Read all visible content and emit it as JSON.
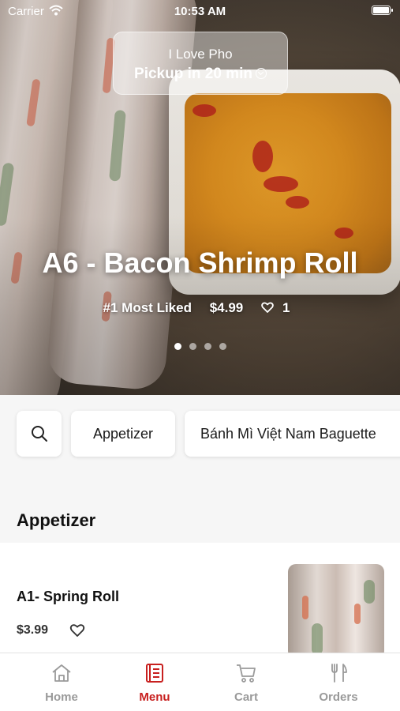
{
  "status_bar": {
    "carrier": "Carrier",
    "time": "10:53 AM"
  },
  "pickup": {
    "store_name": "I Love Pho",
    "eta": "Pickup in 20 min"
  },
  "featured": {
    "title": "A6 - Bacon Shrimp Roll",
    "badge": "#1 Most Liked",
    "price": "$4.99",
    "likes": "1",
    "slides": 4,
    "active_slide": 1
  },
  "categories": {
    "search_icon": "search-icon",
    "items": [
      "Appetizer",
      "Bánh Mì Việt Nam Baguette"
    ]
  },
  "section": {
    "title": "Appetizer"
  },
  "menu_items": [
    {
      "name": "A1- Spring Roll",
      "price": "$3.99"
    }
  ],
  "tabs": [
    {
      "label": "Home",
      "icon": "home-icon",
      "active": false
    },
    {
      "label": "Menu",
      "icon": "menu-icon",
      "active": true
    },
    {
      "label": "Cart",
      "icon": "cart-icon",
      "active": false
    },
    {
      "label": "Orders",
      "icon": "fork-knife-icon",
      "active": false
    }
  ],
  "colors": {
    "accent": "#c8201f",
    "inactive": "#9a9a9a",
    "background": "#f6f6f6"
  }
}
